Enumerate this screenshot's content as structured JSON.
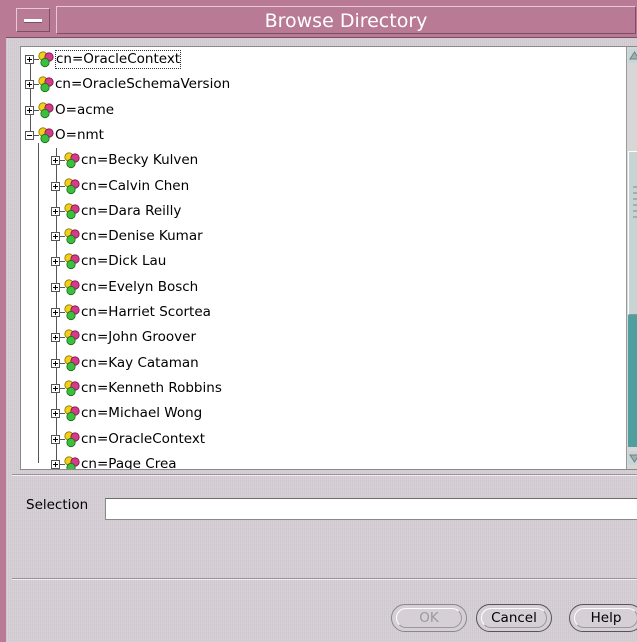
{
  "window": {
    "title": "Browse Directory"
  },
  "tree": {
    "root_items": [
      {
        "label": "cn=OracleContext",
        "expanded": false,
        "selected": true
      },
      {
        "label": "cn=OracleSchemaVersion",
        "expanded": false
      },
      {
        "label": "O=acme",
        "expanded": false
      },
      {
        "label": "O=nmt",
        "expanded": true
      }
    ],
    "children": [
      {
        "label": "cn=Becky Kulven"
      },
      {
        "label": "cn=Calvin Chen"
      },
      {
        "label": "cn=Dara  Reilly"
      },
      {
        "label": "cn=Denise Kumar"
      },
      {
        "label": "cn=Dick Lau"
      },
      {
        "label": "cn=Evelyn Bosch"
      },
      {
        "label": "cn=Harriet Scortea"
      },
      {
        "label": "cn=John Groover"
      },
      {
        "label": "cn=Kay Cataman"
      },
      {
        "label": "cn=Kenneth  Robbins"
      },
      {
        "label": "cn=Michael Wong"
      },
      {
        "label": "cn=OracleContext"
      },
      {
        "label": "cn=Page Crea"
      }
    ]
  },
  "selection": {
    "label": "Selection",
    "value": ""
  },
  "buttons": {
    "ok": "OK",
    "cancel": "Cancel",
    "help": "Help"
  },
  "colors": {
    "titlebar": "#b97a95",
    "scroll_fill": "#4f9f9f"
  }
}
